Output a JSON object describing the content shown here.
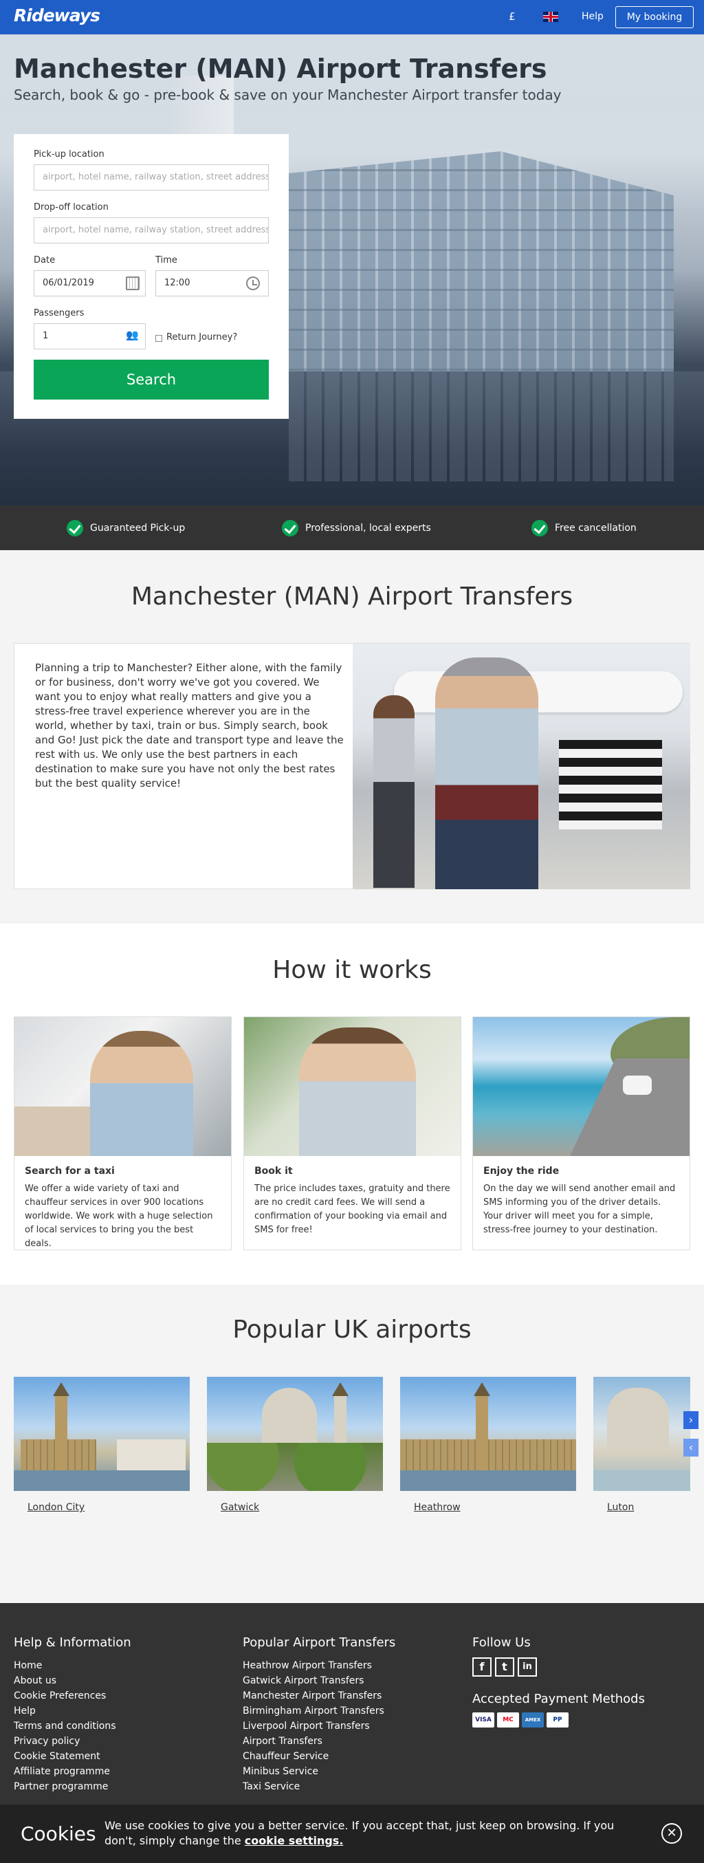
{
  "header": {
    "logo": "Rideways",
    "currency": "£",
    "help": "Help",
    "my_booking": "My booking"
  },
  "hero": {
    "title": "Manchester (MAN) Airport Transfers",
    "subtitle": "Search, book & go - pre-book & save on your Manchester Airport transfer today"
  },
  "search": {
    "pickup_label": "Pick-up location",
    "pickup_placeholder": "airport, hotel name, railway station, street address",
    "dropoff_label": "Drop-off location",
    "dropoff_placeholder": "airport, hotel name, railway station, street address",
    "date_label": "Date",
    "date_value": "06/01/2019",
    "time_label": "Time",
    "time_value": "12:00",
    "passengers_label": "Passengers",
    "passengers_value": "1",
    "return_label": "Return Journey?",
    "button": "Search"
  },
  "usps": [
    "Guaranteed Pick-up",
    "Professional, local experts",
    "Free cancellation"
  ],
  "intro": {
    "title": "Manchester (MAN) Airport Transfers",
    "text": "Planning a trip to Manchester? Either alone, with the family or for business, don't worry we've got you covered. We want you to enjoy what really matters and give you a stress-free travel experience wherever you are in the world, whether by taxi, train or bus. Simply search, book and Go! Just pick the date and transport type and leave the rest with us. We only use the best partners in each destination to make sure you have not only the best rates but the best quality service!"
  },
  "how": {
    "title": "How it works",
    "steps": [
      {
        "title": "Search for a taxi",
        "text": "We offer a wide variety of taxi and chauffeur services in over 900 locations worldwide. We work with a huge selection of local services to bring you the best deals."
      },
      {
        "title": "Book it",
        "text": "The price includes taxes, gratuity and there are no credit card fees. We will send a confirmation of your booking via email and SMS for free!"
      },
      {
        "title": "Enjoy the ride",
        "text": "On the day we will send another email and SMS informing you of the driver details. Your driver will meet you for a simple, stress-free journey to your destination."
      }
    ]
  },
  "airports": {
    "title": "Popular UK airports",
    "items": [
      "London City",
      "Gatwick",
      "Heathrow",
      "Luton"
    ]
  },
  "footer": {
    "help_title": "Help & Information",
    "help_links": [
      "Home",
      "About us",
      "Cookie Preferences",
      "Help",
      "Terms and conditions",
      "Privacy policy",
      "Cookie Statement",
      "Affiliate programme",
      "Partner programme"
    ],
    "popular_title": "Popular Airport Transfers",
    "popular_links": [
      "Heathrow Airport Transfers",
      "Gatwick Airport Transfers",
      "Manchester Airport Transfers",
      "Birmingham Airport Transfers",
      "Liverpool Airport Transfers",
      "Airport Transfers",
      "Chauffeur Service",
      "Minibus Service",
      "Taxi Service"
    ],
    "follow_title": "Follow Us",
    "social": [
      "f",
      "t",
      "in"
    ],
    "payments_title": "Accepted Payment Methods",
    "payments": [
      "VISA",
      "MC",
      "AMEX",
      "PP"
    ]
  },
  "cookie": {
    "title": "Cookies",
    "text": "We use cookies to give you a better service. If you accept that, just keep on browsing. If you don't, simply change the",
    "link": "cookie settings."
  },
  "colors": {
    "brand_blue": "#1f5ec6",
    "cta_green": "#0aa556",
    "dark": "#333333"
  }
}
